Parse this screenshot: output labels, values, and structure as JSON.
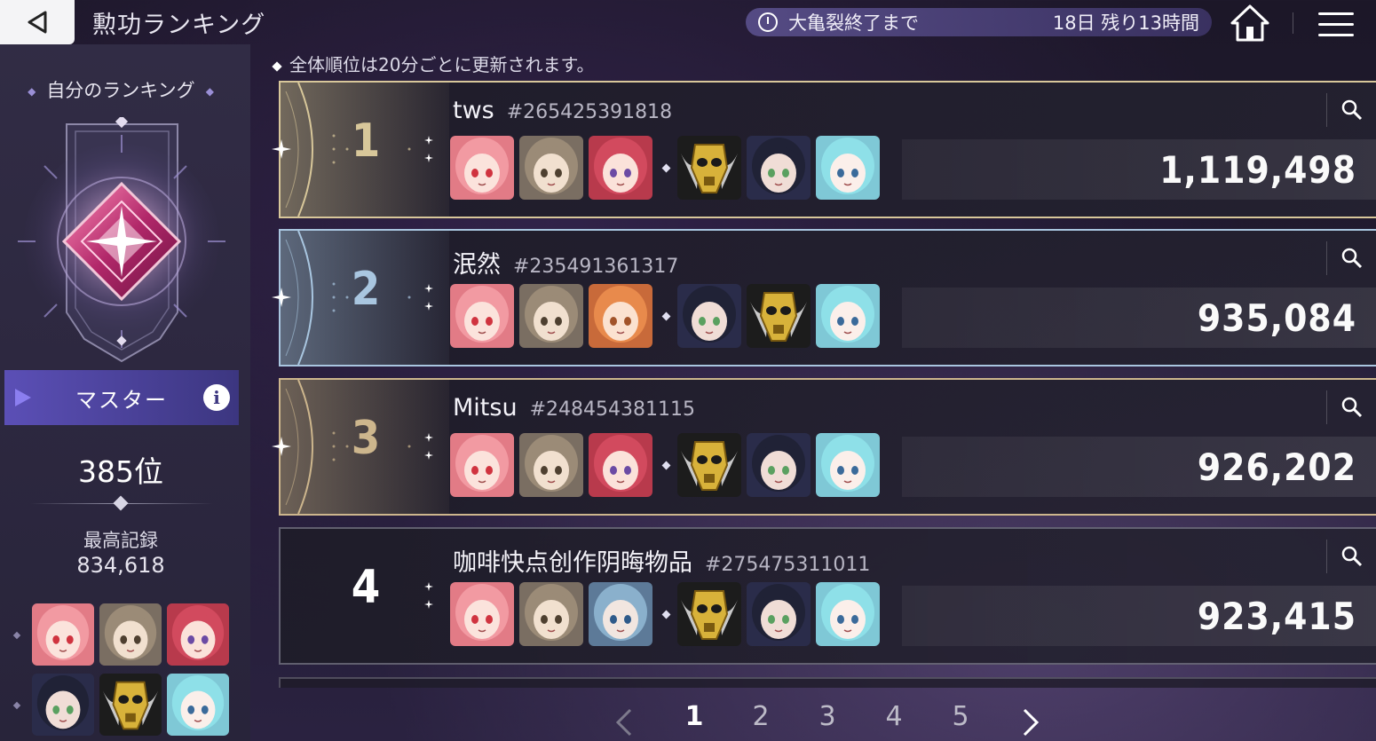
{
  "header": {
    "title": "勲功ランキング",
    "event_label": "大亀裂終了まで",
    "event_remaining": "18日 残り13時間",
    "icons": [
      "back-arrow-icon",
      "clock-icon",
      "home-icon",
      "menu-icon"
    ]
  },
  "my_ranking": {
    "title": "自分のランキング",
    "tier": "マスター",
    "info_symbol": "i",
    "rank": "385位",
    "best_label": "最高記録",
    "best_value": "834,618",
    "team": [
      "pink-hair-girl",
      "brown-hair-girl",
      "red-hair-girl",
      "dark-hair-girl",
      "gold-skull-mask",
      "cyan-hair-glasses-girl"
    ]
  },
  "notice": "全体順位は20分ごとに更新されます。",
  "rows": [
    {
      "rank": "1",
      "name": "tws",
      "id": "#265425391818",
      "score": "1,119,498",
      "medal": "gold",
      "team": [
        "pink-hair-girl",
        "brown-hair-girl",
        "red-hair-girl",
        "gold-skull-mask",
        "dark-hair-girl",
        "cyan-hair-glasses-girl"
      ]
    },
    {
      "rank": "2",
      "name": "泯然",
      "id": "#235491361317",
      "score": "935,084",
      "medal": "silver",
      "team": [
        "pink-hair-girl",
        "brown-hair-girl",
        "orange-hat-girl",
        "dark-hair-girl",
        "gold-skull-mask",
        "cyan-hair-glasses-girl"
      ]
    },
    {
      "rank": "3",
      "name": "Mitsu",
      "id": "#248454381115",
      "score": "926,202",
      "medal": "bronze",
      "team": [
        "pink-hair-girl",
        "brown-hair-girl",
        "red-hair-girl",
        "gold-skull-mask",
        "dark-hair-girl",
        "cyan-hair-glasses-girl"
      ]
    },
    {
      "rank": "4",
      "name": "咖啡快点创作阴晦物品",
      "id": "#275475311011",
      "score": "923,415",
      "medal": "none",
      "team": [
        "pink-hair-girl",
        "brown-hair-girl",
        "blue-hair-headphones-girl",
        "gold-skull-mask",
        "dark-hair-girl",
        "cyan-hair-glasses-girl"
      ]
    }
  ],
  "pagination": {
    "pages": [
      "1",
      "2",
      "3",
      "4",
      "5"
    ],
    "current": "1"
  },
  "colors": {
    "gold": "#d8c79a",
    "silver": "#a9c6e0",
    "bronze": "#cdb68d",
    "accent_purple": "#5b4fb6"
  }
}
